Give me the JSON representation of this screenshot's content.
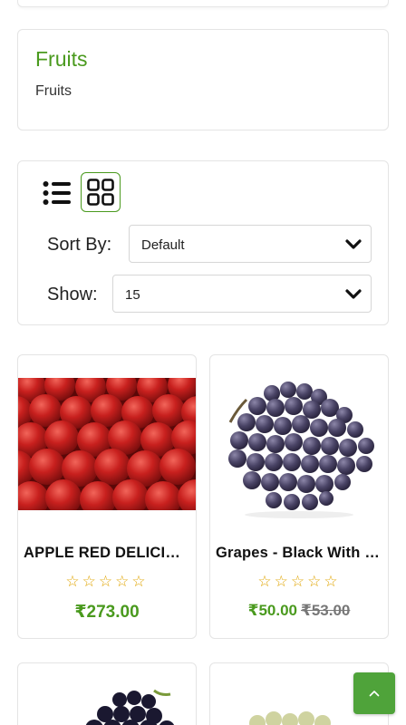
{
  "category": {
    "title": "Fruits",
    "description": "Fruits"
  },
  "toolbar": {
    "list_view_icon": "list-icon",
    "grid_view_icon": "grid-icon",
    "sort_label": "Sort By:",
    "sort_value": "Default",
    "show_label": "Show:",
    "show_value": "15"
  },
  "products": [
    {
      "name": "APPLE RED DELICIOUS",
      "rating": 0,
      "max_rating": 5,
      "stars": "☆☆☆☆☆",
      "price": "₹273.00",
      "old_price": ""
    },
    {
      "name": "Grapes - Black With Seeds",
      "rating": 0,
      "max_rating": 5,
      "stars": "☆☆☆☆☆",
      "price": "₹50.00",
      "old_price": "₹53.00"
    }
  ],
  "scroll_top_icon": "chevron-up-icon",
  "colors": {
    "accent": "#4a9a1e",
    "button": "#4fa33a",
    "star": "#e0a400"
  }
}
